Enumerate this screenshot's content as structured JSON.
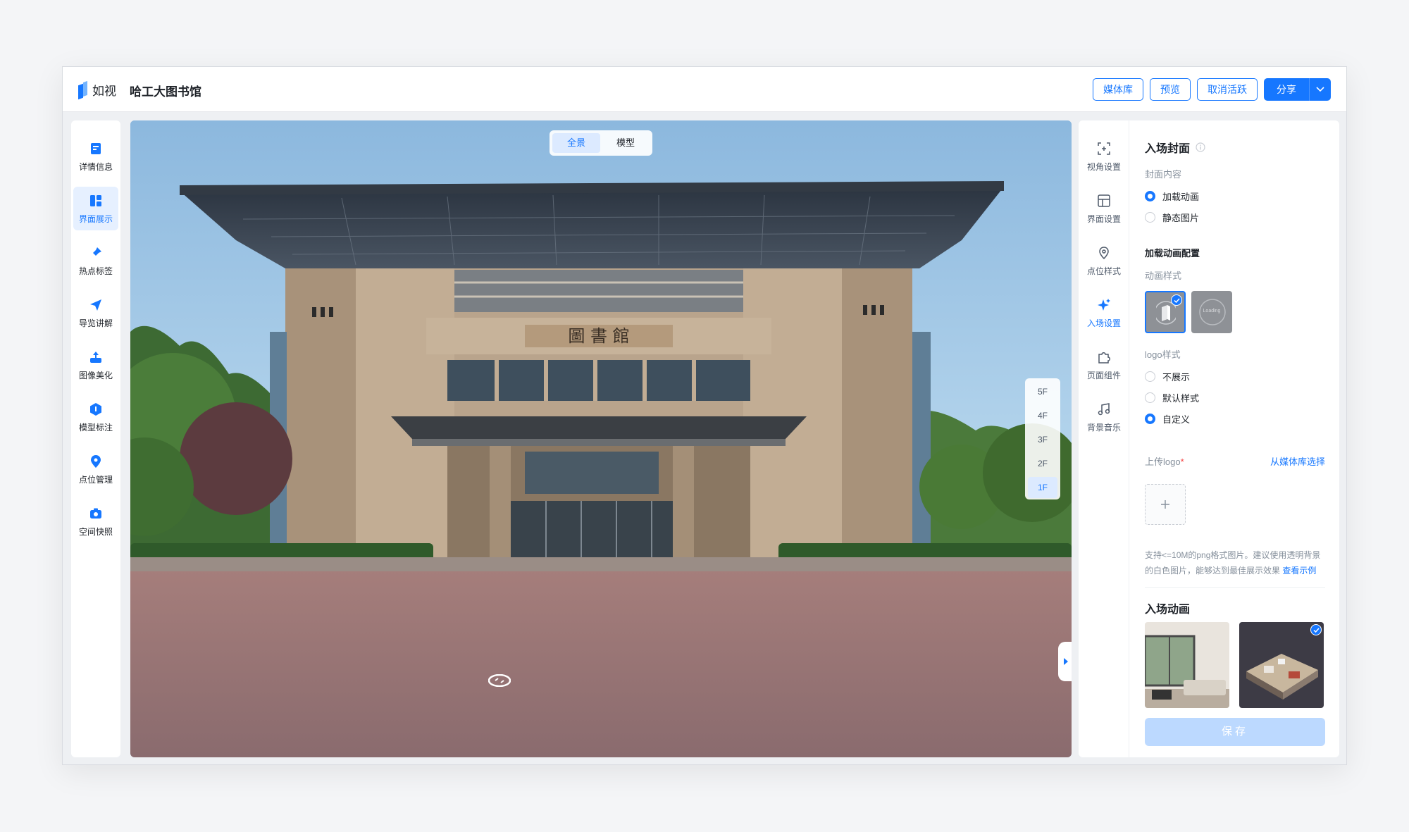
{
  "header": {
    "brand": "如视",
    "project_title": "哈工大图书馆",
    "buttons": {
      "media_library": "媒体库",
      "preview": "预览",
      "deactivate": "取消活跃",
      "share": "分享"
    }
  },
  "left_nav": {
    "items": [
      {
        "label": "详情信息",
        "icon": "doc-icon"
      },
      {
        "label": "界面展示",
        "icon": "layout-icon",
        "active": true
      },
      {
        "label": "热点标签",
        "icon": "pin-icon"
      },
      {
        "label": "导览讲解",
        "icon": "send-icon"
      },
      {
        "label": "图像美化",
        "icon": "image-enhance-icon"
      },
      {
        "label": "模型标注",
        "icon": "cube-icon"
      },
      {
        "label": "点位管理",
        "icon": "location-icon"
      },
      {
        "label": "空间快照",
        "icon": "camera-icon"
      }
    ]
  },
  "viewer": {
    "modes": [
      "全景",
      "模型"
    ],
    "active_mode": "全景",
    "floors": [
      "5F",
      "4F",
      "3F",
      "2F",
      "1F"
    ],
    "active_floor": "1F",
    "building_sign": "圖 書 館"
  },
  "right_rail": {
    "items": [
      {
        "label": "视角设置",
        "icon": "viewpoint-icon"
      },
      {
        "label": "界面设置",
        "icon": "interface-icon"
      },
      {
        "label": "点位样式",
        "icon": "location-style-icon"
      },
      {
        "label": "入场设置",
        "icon": "sparkle-icon",
        "active": true
      },
      {
        "label": "页面组件",
        "icon": "puzzle-icon"
      },
      {
        "label": "背景音乐",
        "icon": "music-icon"
      }
    ]
  },
  "settings": {
    "entry_cover_title": "入场封面",
    "cover_content_label": "封面内容",
    "cover_options": [
      "加载动画",
      "静态图片"
    ],
    "cover_selected": "加载动画",
    "loading_config_title": "加载动画配置",
    "anim_style_label": "动画样式",
    "anim_loading_text": "Loading",
    "logo_style_label": "logo样式",
    "logo_options": [
      "不展示",
      "默认样式",
      "自定义"
    ],
    "logo_selected": "自定义",
    "upload_logo_label": "上传logo",
    "required_mark": "*",
    "choose_from_media": "从媒体库选择",
    "upload_hint": "支持<=10M的png格式图片。建议使用透明背景的白色图片，能够达到最佳展示效果",
    "view_example": "查看示例",
    "entry_anim_title": "入场动画",
    "save_label": "保存"
  },
  "colors": {
    "accent": "#1677ff",
    "accent_light": "#e6f0ff",
    "save_disabled": "#bcd9ff"
  }
}
